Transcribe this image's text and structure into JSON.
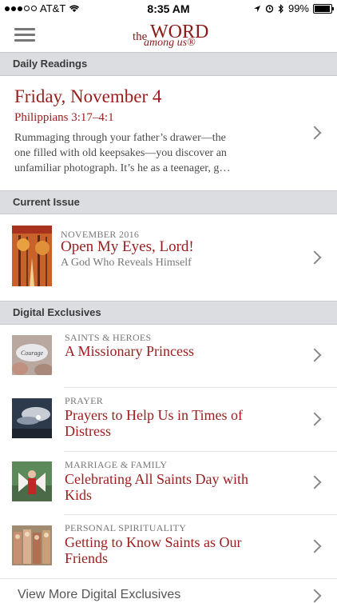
{
  "status_bar": {
    "carrier": "AT&T",
    "time": "8:35 AM",
    "battery": "99%"
  },
  "app": {
    "logo_the": "the",
    "logo_word": "WORD",
    "logo_among": "among us®"
  },
  "sections": {
    "daily": "Daily Readings",
    "current": "Current Issue",
    "digital": "Digital Exclusives"
  },
  "daily_reading": {
    "date": "Friday, November 4",
    "reference": "Philippians 3:17–4:1",
    "excerpt": "Rummaging through your father’s drawer—the one filled with old keepsakes—you discover an unfamiliar photograph. It’s he as a teenager, g…"
  },
  "current_issue": {
    "month": "NOVEMBER 2016",
    "title": "Open My Eyes, Lord!",
    "subtitle": "A God Who Reveals Himself"
  },
  "digital_exclusives": [
    {
      "category": "SAINTS & HEROES",
      "title": "A Missionary Princess",
      "thumb_text": "Courage"
    },
    {
      "category": "PRAYER",
      "title": "Prayers to Help Us in Times of Distress"
    },
    {
      "category": "MARRIAGE & FAMILY",
      "title": "Celebrating All Saints Day with Kids"
    },
    {
      "category": "PERSONAL SPIRITUALITY",
      "title": "Getting to Know Saints as Our Friends"
    }
  ],
  "view_more": "View More Digital Exclusives",
  "colors": {
    "accent": "#9b1c1c",
    "section_bg": "#dcdde0"
  }
}
